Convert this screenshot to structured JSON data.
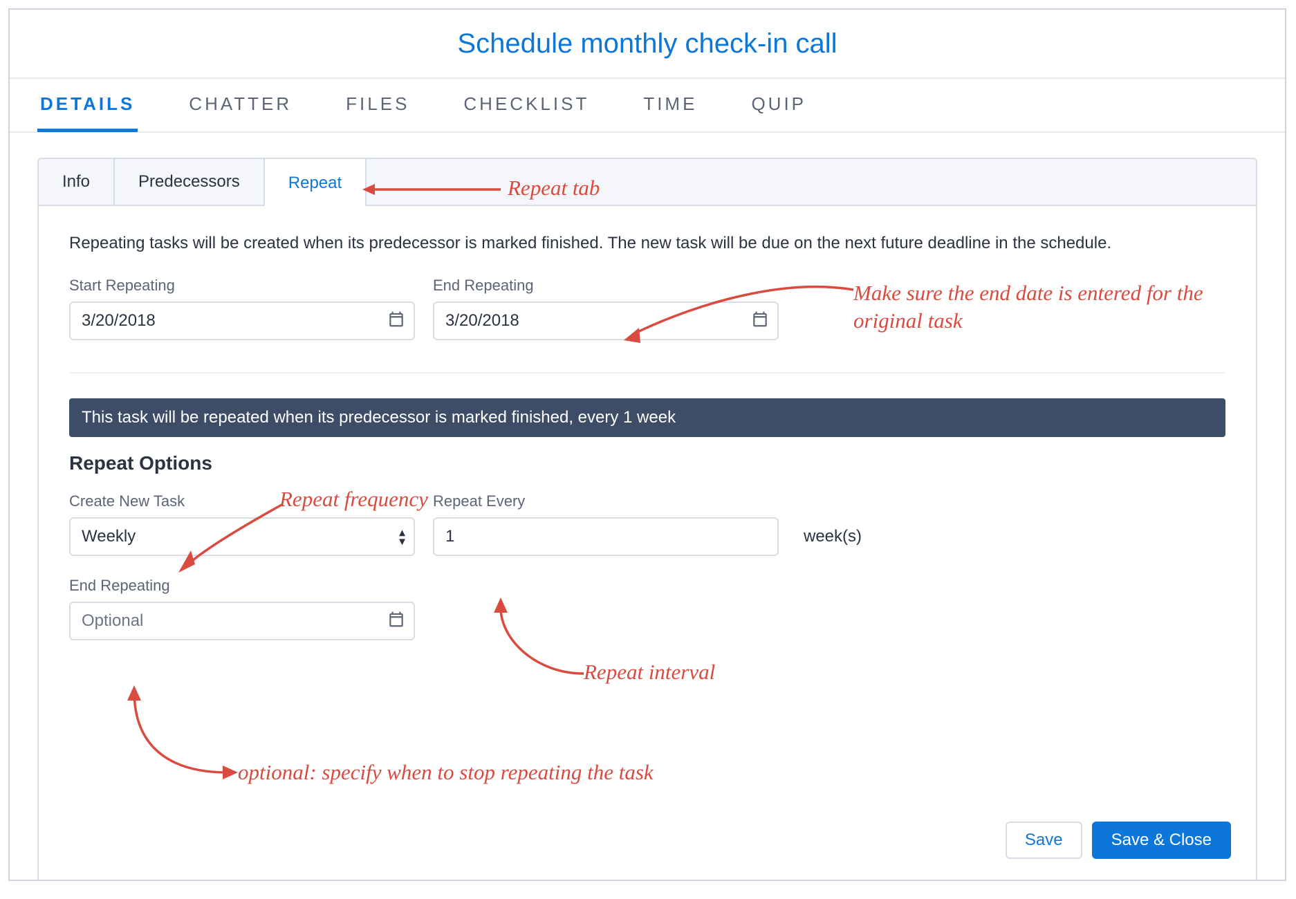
{
  "header": {
    "title": "Schedule monthly check-in call"
  },
  "main_tabs": {
    "details": "DETAILS",
    "chatter": "CHATTER",
    "files": "FILES",
    "checklist": "CHECKLIST",
    "time": "TIME",
    "quip": "QUIP",
    "active": "details"
  },
  "sub_tabs": {
    "info": "Info",
    "predecessors": "Predecessors",
    "repeat": "Repeat",
    "active": "repeat"
  },
  "repeat_panel": {
    "description": "Repeating tasks will be created when its predecessor is marked finished. The new task will be due on the next future deadline in the schedule.",
    "start_label": "Start Repeating",
    "start_value": "3/20/2018",
    "end_label": "End Repeating",
    "end_value": "3/20/2018",
    "summary": "This task will be repeated when its predecessor is marked finished, every 1 week",
    "options_heading": "Repeat Options",
    "create_label": "Create New Task",
    "create_value": "Weekly",
    "every_label": "Repeat Every",
    "every_value": "1",
    "every_unit": "week(s)",
    "end2_label": "End Repeating",
    "end2_placeholder": "Optional"
  },
  "buttons": {
    "save": "Save",
    "save_close": "Save & Close"
  },
  "annotations": {
    "repeat_tab": "Repeat tab",
    "end_date": "Make sure the end date is entered for the original task",
    "freq": "Repeat frequency",
    "interval": "Repeat interval",
    "optional": "optional: specify when to stop repeating the task"
  }
}
